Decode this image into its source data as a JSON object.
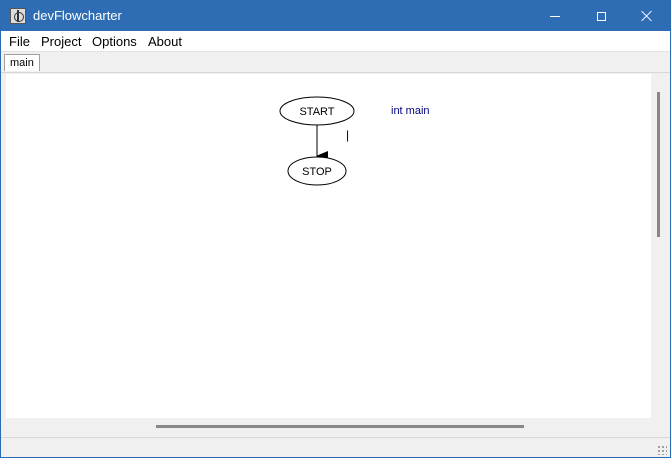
{
  "window": {
    "title": "devFlowcharter",
    "icon": "app-icon"
  },
  "menu": {
    "items": [
      {
        "label": "File"
      },
      {
        "label": "Project"
      },
      {
        "label": "Options"
      },
      {
        "label": "About"
      }
    ]
  },
  "tabs": [
    {
      "label": "main",
      "active": true
    }
  ],
  "flowchart": {
    "start_label": "START",
    "stop_label": "STOP",
    "function_header": "int main",
    "cursor_text": "|",
    "header_color": "#000080"
  }
}
